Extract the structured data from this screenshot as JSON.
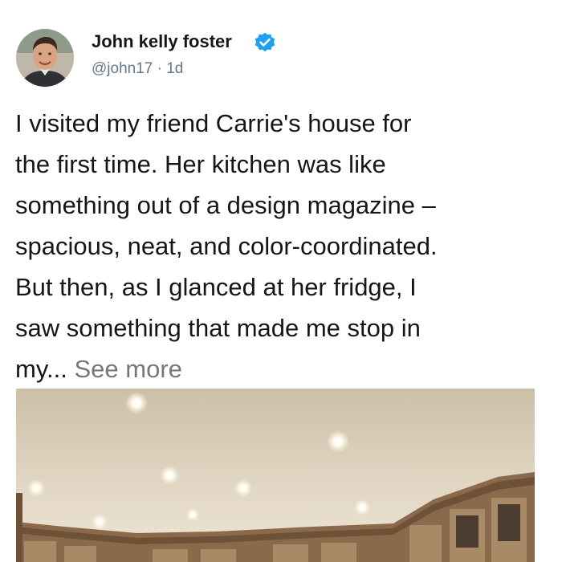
{
  "author": {
    "display_name": "John kelly foster",
    "handle": "@john17",
    "separator": " · ",
    "time_ago": "1d",
    "verified": true,
    "avatar_icon": "profile-photo"
  },
  "tweet": {
    "lines": [
      "I visited my friend Carrie's house for",
      "the first time. Her kitchen was like",
      "something out of a design magazine –",
      "spacious, neat, and color-coordinated.",
      "But then, as I glanced at her fridge, I",
      "saw something that made me stop in",
      "my..."
    ],
    "see_more": "See more"
  },
  "colors": {
    "verified_blue": "#1da1f2",
    "secondary_text": "#657786",
    "see_more": "#777777"
  }
}
